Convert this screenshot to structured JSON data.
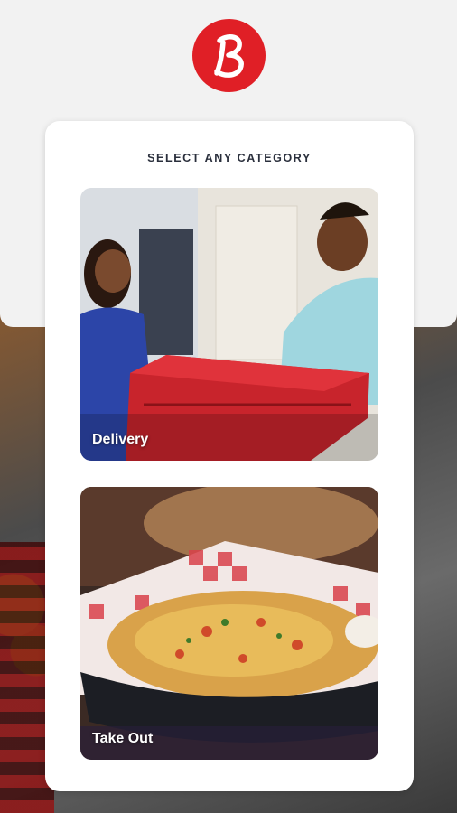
{
  "app": {
    "logo_icon": "brand-b-logo-icon",
    "brand_color": "#e01f26"
  },
  "card": {
    "title": "SELECT ANY CATEGORY"
  },
  "categories": [
    {
      "label": "Delivery",
      "image": "delivery-person-handing-bag-photo"
    },
    {
      "label": "Take Out",
      "image": "nachos-basket-photo"
    }
  ]
}
